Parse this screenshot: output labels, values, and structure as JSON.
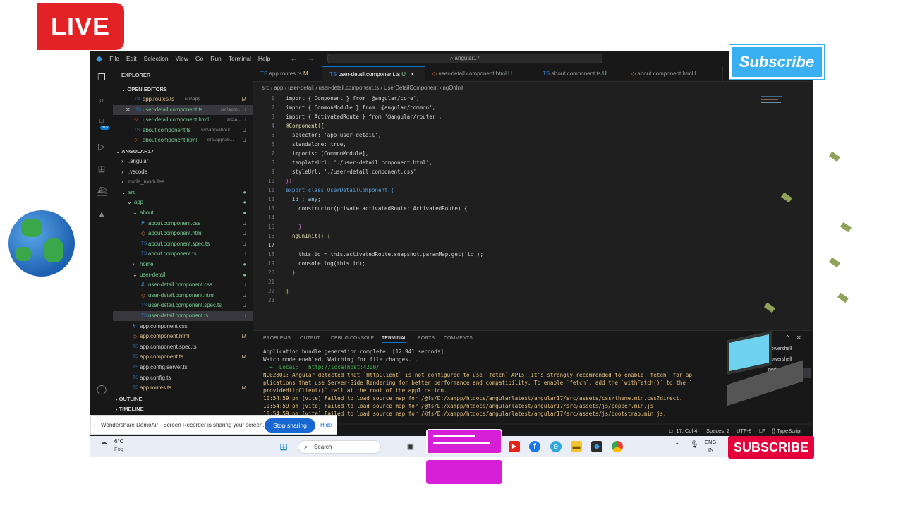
{
  "overlay": {
    "live_label": "LIVE",
    "subscribe_top": "Subscribe",
    "subscribe_bottom": "SUBSCRIBE"
  },
  "menubar": {
    "items": [
      "File",
      "Edit",
      "Selection",
      "View",
      "Go",
      "Run",
      "Terminal",
      "Help"
    ],
    "search_text": "angular17"
  },
  "activity": {
    "badge": "315"
  },
  "sidebar": {
    "explorer_title": "EXPLORER",
    "open_editors_title": "OPEN EDITORS",
    "open_editors": [
      {
        "name": "app.routes.ts",
        "path": "src\\app",
        "status": "M"
      },
      {
        "name": "user-detail.component.ts",
        "path": "src\\app\\...",
        "status": "U"
      },
      {
        "name": "user-detail.component.html",
        "path": "src\\a...",
        "status": "U"
      },
      {
        "name": "about.component.ts",
        "path": "src\\app\\about",
        "status": "U"
      },
      {
        "name": "about.component.html",
        "path": "src\\app\\ab...",
        "status": "U"
      }
    ],
    "project_title": "ANGULAR17",
    "tree": [
      {
        "name": ".angular",
        "status": ""
      },
      {
        "name": ".vscode",
        "status": ""
      },
      {
        "name": "node_modules",
        "status": ""
      },
      {
        "name": "src",
        "status": "●"
      },
      {
        "name": "app",
        "status": "●"
      },
      {
        "name": "about",
        "status": "●"
      },
      {
        "name": "about.component.css",
        "status": "U"
      },
      {
        "name": "about.component.html",
        "status": "U"
      },
      {
        "name": "about.component.spec.ts",
        "status": "U"
      },
      {
        "name": "about.component.ts",
        "status": "U"
      },
      {
        "name": "home",
        "status": "●"
      },
      {
        "name": "user-detail",
        "status": "●"
      },
      {
        "name": "user-detail.component.css",
        "status": "U"
      },
      {
        "name": "user-detail.component.html",
        "status": "U"
      },
      {
        "name": "user-detail.component.spec.ts",
        "status": "U"
      },
      {
        "name": "user-detail.component.ts",
        "status": "U"
      },
      {
        "name": "app.component.css",
        "status": ""
      },
      {
        "name": "app.component.html",
        "status": "M"
      },
      {
        "name": "app.component.spec.ts",
        "status": ""
      },
      {
        "name": "app.component.ts",
        "status": "M"
      },
      {
        "name": "app.config.server.ts",
        "status": ""
      },
      {
        "name": "app.config.ts",
        "status": ""
      },
      {
        "name": "app.routes.ts",
        "status": "M"
      }
    ],
    "outline": "OUTLINE",
    "timeline": "TIMELINE"
  },
  "tabs": [
    {
      "label": "app.routes.ts",
      "status": "M"
    },
    {
      "label": "user-detail.component.ts",
      "status": "U"
    },
    {
      "label": "user-detail.component.html",
      "status": "U"
    },
    {
      "label": "about.component.ts",
      "status": "U"
    },
    {
      "label": "about.component.html",
      "status": "U"
    }
  ],
  "breadcrumb": "src › app › user-detail › user-detail.component.ts › UserDetailComponent › ngOnInit",
  "code_lines": [
    "1",
    "2",
    "3",
    "4",
    "5",
    "6",
    "7",
    "8",
    "9",
    "10",
    "11",
    "12",
    "13",
    "14",
    "15",
    "16",
    "17",
    "18",
    "19",
    "20",
    "21",
    "22",
    "23"
  ],
  "code": {
    "l1": "import { Component } from '@angular/core';",
    "l2": "import { CommonModule } from '@angular/common';",
    "l3": "import { ActivatedRoute } from '@angular/router';",
    "l4": "@Component({",
    "l5": "  selector: 'app-user-detail',",
    "l6": "  standalone: true,",
    "l7": "  imports: [CommonModule],",
    "l8": "  templateUrl: './user-detail.component.html',",
    "l9": "  styleUrl: './user-detail.component.css'",
    "l10": "})",
    "l11": "export class UserDetailComponent {",
    "l12": "  id : any;",
    "l13": "    constructor(private activatedRoute: ActivatedRoute) {",
    "l15": "    }",
    "l16": "  ngOnInit() {",
    "l18": "    this.id = this.activatedRoute.snapshot.paramMap.get('id');",
    "l19": "    console.log(this.id);",
    "l20": "  }",
    "l22": "}"
  },
  "panel": {
    "tabs": [
      "PROBLEMS",
      "OUTPUT",
      "DEBUG CONSOLE",
      "TERMINAL",
      "PORTS",
      "COMMENTS"
    ],
    "terminals": [
      "powershell",
      "powershell",
      "node"
    ],
    "lines": [
      "Application bundle generation complete. [12.941 seconds]",
      "Watch mode enabled. Watching for file changes...",
      "  ➜  Local:   http://localhost:4200/",
      "NG02801: Angular detected that `HttpClient` is not configured to use `fetch` APIs. It's strongly recommended to enable `fetch` for ap",
      "plications that use Server-Side Rendering for better performance and compatibility. To enable `fetch`, add the `withFetch()` to the `",
      "provideHttpClient()` call at the root of the application.",
      "10:54:59 pm [vite] Failed to load source map for /@fs/D:/xampp/htdocs/angularlatest/angular17/src/assets/css/theme.min.css?direct.",
      "10:54:59 pm [vite] Failed to load source map for /@fs/D:/xampp/htdocs/angularlatest/angular17/src/assets/js/popper.min.js.",
      "10:54:59 pm [vite] Failed to load source map for /@fs/D:/xampp/htdocs/angularlatest/angular17/src/assets/js/bootstrap.min.js."
    ]
  },
  "statusbar": {
    "position": "Ln 17, Col 4",
    "spaces": "Spaces: 2",
    "encoding": "UTF-8",
    "eol": "LF",
    "language": "{} TypeScript"
  },
  "share_notice": {
    "text": "Wondershare DemoAir - Screen Recorder is sharing your screen.",
    "stop": "Stop sharing",
    "hide": "Hide"
  },
  "taskbar": {
    "weather_temp": "6°C",
    "weather_desc": "Fog",
    "search": "Search",
    "lang": "ENG",
    "region": "IN"
  }
}
